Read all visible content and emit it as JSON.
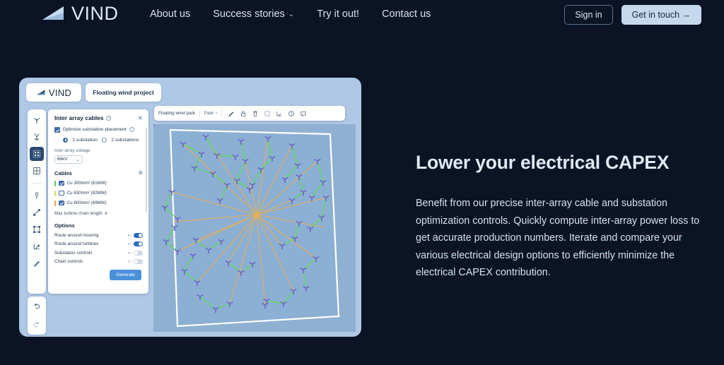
{
  "navbar": {
    "logo_text": "VIND",
    "logo_icon": "vind-wave-logo",
    "links": [
      {
        "label": "About us",
        "icon": null
      },
      {
        "label": "Success stories",
        "icon": "chevron-down-icon"
      },
      {
        "label": "Try it out!",
        "icon": null
      },
      {
        "label": "Contact us",
        "icon": null
      }
    ],
    "sign_in_label": "Sign in",
    "cta_label": "Get in touch →"
  },
  "hero": {
    "heading": "Lower your electrical CAPEX",
    "body": "Benefit from our precise inter-array cable and substation optimization controls. Quickly compute inter-array power loss to get accurate production numbers. Iterate and compare your various electrical design options to efficiently minimize the electrical CAPEX contribution."
  },
  "app": {
    "topbar": {
      "logo_text": "VIND",
      "project_name": "Floating wind project"
    },
    "rail": {
      "tools": [
        {
          "name": "turbine-tool",
          "glyph": "turbine",
          "active": false
        },
        {
          "name": "mooring-tool",
          "glyph": "mooring",
          "active": false
        },
        {
          "name": "array-layout-tool",
          "glyph": "array",
          "active": true
        },
        {
          "name": "grid-tool",
          "glyph": "grid",
          "active": false
        },
        {
          "name": "point-tool",
          "glyph": "pin",
          "active": false
        },
        {
          "name": "measure-tool",
          "glyph": "ruler",
          "active": false
        },
        {
          "name": "polygon-tool",
          "glyph": "polygon",
          "active": false
        },
        {
          "name": "area-tool",
          "glyph": "area",
          "active": false
        },
        {
          "name": "pencil-tool",
          "glyph": "pencil",
          "active": false
        }
      ],
      "history": [
        {
          "name": "undo-button",
          "glyph": "undo"
        },
        {
          "name": "redo-button",
          "glyph": "redo"
        }
      ]
    },
    "panel": {
      "title": "Inter array cables",
      "info_glyph": "?",
      "close_glyph": "✕",
      "optimize_label": "Optimize substation placement",
      "optimize_checked": true,
      "substation_options": [
        {
          "label": "1 substation",
          "selected": true
        },
        {
          "label": "2 substations",
          "selected": false
        }
      ],
      "voltage_label": "Inter array voltage",
      "voltage_value": "66kV",
      "cables_heading": "Cables",
      "cables_gear": "⚙",
      "cables": [
        {
          "label": "Cu 300mm² (61MW)",
          "checked": true,
          "color": "#5ec45e"
        },
        {
          "label": "Cu 630mm² (82MW)",
          "checked": false,
          "color": "#d9de4e"
        },
        {
          "label": "Cu 800mm² (89MW)",
          "checked": true,
          "color": "#e8a33c"
        }
      ],
      "chain_length_text": "Max turbine chain length: 4",
      "options_heading": "Options",
      "options": [
        {
          "label": "Route around mooring",
          "on": true
        },
        {
          "label": "Route around turbines",
          "on": true
        },
        {
          "label": "Substation controls",
          "on": false
        },
        {
          "label": "Chain controls",
          "on": false
        }
      ],
      "generate_label": "Generate"
    },
    "map": {
      "breadcrumb_project": "Floating wind park",
      "breadcrumb_layer": "Park",
      "breadcrumb_chevron": "›",
      "tools": [
        {
          "name": "edit-pencil-icon"
        },
        {
          "name": "lock-icon"
        },
        {
          "name": "trash-icon"
        },
        {
          "name": "select-area-icon"
        },
        {
          "name": "measure-icon"
        },
        {
          "name": "history-icon"
        },
        {
          "name": "comment-icon"
        }
      ]
    }
  },
  "colors": {
    "page_bg": "#0b1324",
    "card_bg": "#aec8e5",
    "accent": "#c5d9ee",
    "sea": "#8fb0d0",
    "park_fill": "#8dafd2",
    "cable_green": "#5ddc5d",
    "cable_orange": "#eab04f",
    "turbine": "#6b5fc9"
  }
}
